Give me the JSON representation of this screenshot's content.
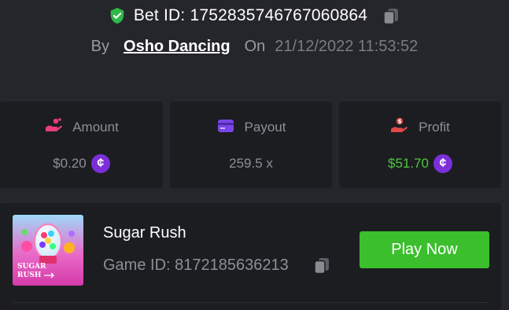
{
  "bet": {
    "id_label": "Bet ID: 1752835746767060864",
    "by_label": "By",
    "user": "Osho Dancing",
    "on_label": "On",
    "date": "21/12/2022 11:53:52"
  },
  "stats": {
    "amount": {
      "label": "Amount",
      "value": "$0.20",
      "icon": "hand-coin-icon"
    },
    "payout": {
      "label": "Payout",
      "value": "259.5 x",
      "icon": "card-icon"
    },
    "profit": {
      "label": "Profit",
      "value": "$51.70",
      "icon": "hand-dollar-icon"
    }
  },
  "game": {
    "title": "Sugar Rush",
    "id_label": "Game ID: 8172185636213",
    "play_label": "Play Now",
    "thumb_text": "SUGAR RUSH"
  },
  "colors": {
    "background": "#25262b",
    "card": "#1c1d21",
    "accent_green": "#3bbf2d",
    "profit_green": "#4cc83a",
    "coin_purple": "#7c2fd9",
    "amount_pink": "#e83e7a",
    "payout_purple": "#7a45e8",
    "profit_red": "#e24a4a"
  }
}
